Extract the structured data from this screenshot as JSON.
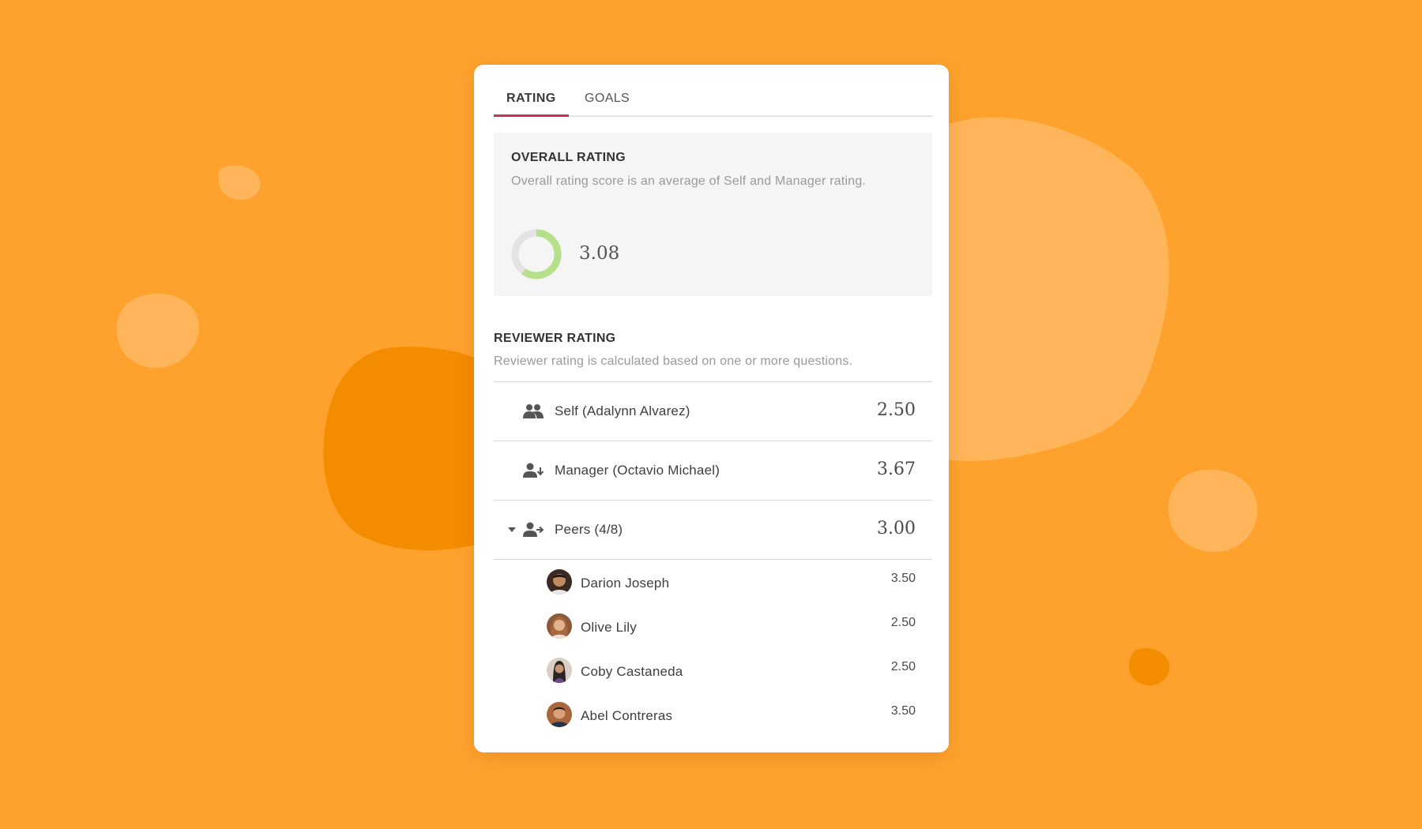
{
  "tabs": [
    {
      "label": "RATING",
      "active": true
    },
    {
      "label": "GOALS",
      "active": false
    }
  ],
  "overall": {
    "title": "OVERALL RATING",
    "description": "Overall rating score is an average of Self and Manager rating.",
    "score": "3.08",
    "progress_fraction": 0.6,
    "ring_color": "#b6e08a",
    "ring_track_color": "#e3e3e3"
  },
  "reviewer": {
    "title": "REVIEWER RATING",
    "description": "Reviewer rating is calculated based on one or more questions.",
    "rows": [
      {
        "icon": "people-icon",
        "label": "Self (Adalynn Alvarez)",
        "score": "2.50"
      },
      {
        "icon": "person-arrow-down-icon",
        "label": "Manager (Octavio Michael)",
        "score": "3.67"
      },
      {
        "icon": "person-arrow-right-icon",
        "label": "Peers (4/8)",
        "score": "3.00",
        "expanded": true
      }
    ],
    "peers": [
      {
        "name": "Darion Joseph",
        "score": "3.50"
      },
      {
        "name": "Olive Lily",
        "score": "2.50"
      },
      {
        "name": "Coby Castaneda",
        "score": "2.50"
      },
      {
        "name": "Abel Contreras",
        "score": "3.50"
      }
    ]
  },
  "colors": {
    "background": "#FFA22D",
    "accent_tab_underline": "#cf2f4a"
  }
}
